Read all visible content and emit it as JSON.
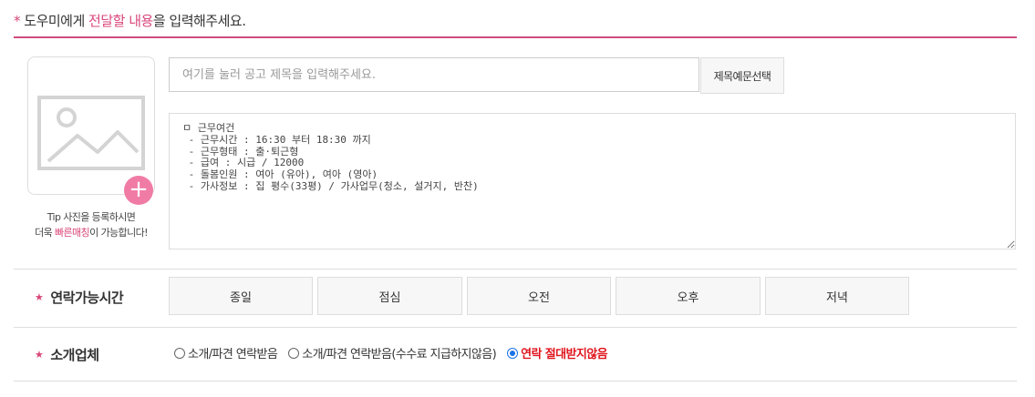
{
  "header": {
    "star": "*",
    "pre": " 도우미에게 ",
    "highlight1": "전달할",
    "space": " ",
    "highlight2": "내용",
    "post": "을 입력해주세요."
  },
  "photo": {
    "tip_line1": "Tip 사진을 등록하시면",
    "tip_line2_pre": "더욱 ",
    "tip_line2_highlight": "빠른매칭",
    "tip_line2_post": "이 가능합니다!",
    "plus": "+"
  },
  "title_input": {
    "placeholder": "여기를 눌러 공고 제목을 입력해주세요.",
    "value": ""
  },
  "example_button": "제목예문선택",
  "content": {
    "value": "ㅁ 근무여건\n - 근무시간 : 16:30 부터 18:30 까지\n - 근무형태 : 출·퇴근형\n - 급여 : 시급 / 12000\n - 돌봄인원 : 여아 (유아), 여아 (영아)\n - 가사정보 : 집 평수(33평) / 가사업무(청소, 설거지, 반찬)"
  },
  "contact_time": {
    "star": "★",
    "label": "연락가능시간",
    "options": [
      "종일",
      "점심",
      "오전",
      "오후",
      "저녁"
    ]
  },
  "agency": {
    "star": "★",
    "label": "소개업체",
    "options": [
      {
        "label": "소개/파견 연락받음",
        "checked": false
      },
      {
        "label": "소개/파견 연락받음(수수료 지급하지않음)",
        "checked": false
      },
      {
        "label": "연락 절대받지않음",
        "checked": true
      }
    ]
  },
  "colors": {
    "accent_pink": "#d04c7e",
    "plus_pink": "#f07ba4",
    "selected_red": "#e0151d",
    "radio_blue": "#1a73e8"
  }
}
